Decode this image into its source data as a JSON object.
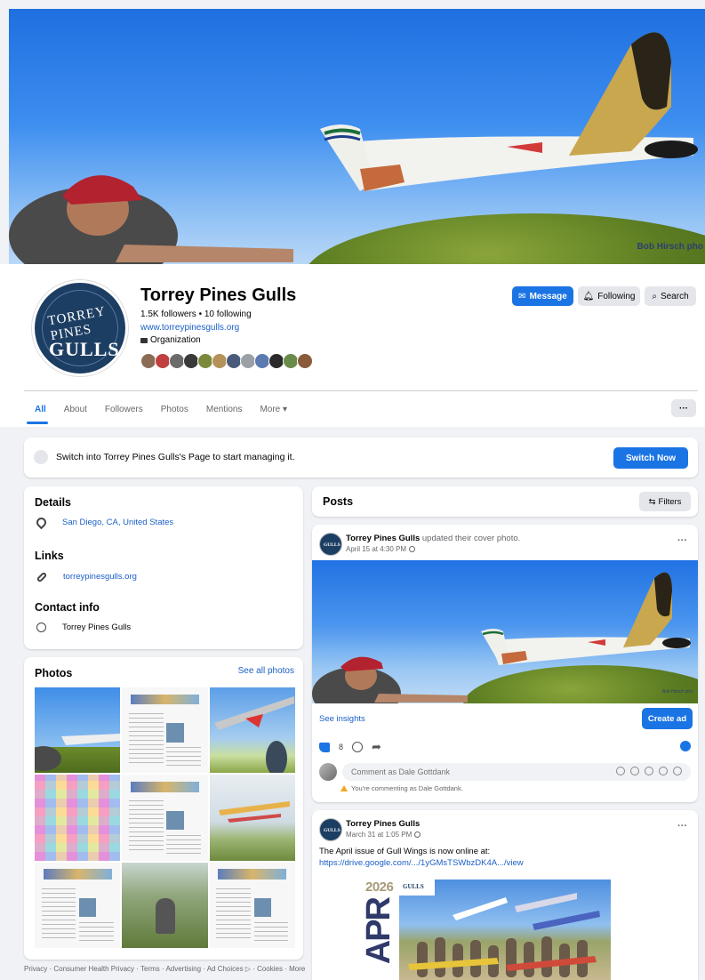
{
  "cover": {
    "credit": "Bob Hirsch pho"
  },
  "profile": {
    "name": "Torrey Pines Gulls",
    "stats": "1.5K followers • 10 following",
    "website": "www.torreypinesgulls.org",
    "category": "Organization",
    "avatar_top": "TORREY PINES",
    "avatar_bottom": "GULLS"
  },
  "actions": {
    "message": "Message",
    "following": "Following",
    "search": "Search"
  },
  "tabs": [
    {
      "label": "All"
    },
    {
      "label": "About"
    },
    {
      "label": "Followers"
    },
    {
      "label": "Photos"
    },
    {
      "label": "Mentions"
    },
    {
      "label": "More ▾"
    }
  ],
  "more_dots": "···",
  "switch_banner": {
    "text": "Switch into Torrey Pines Gulls's Page to start managing it.",
    "button": "Switch Now"
  },
  "details": {
    "title": "Details",
    "location": "San Diego, CA, United States",
    "links_title": "Links",
    "link": "torreypinesgulls.org",
    "contact_title": "Contact info",
    "contact": "Torrey Pines Gulls"
  },
  "photos": {
    "title": "Photos",
    "see_all": "See all photos"
  },
  "footer": "Privacy · Consumer Health Privacy · Terms · Advertising · Ad Choices ▷ · Cookies · More",
  "posts": {
    "title": "Posts",
    "filters": "Filters",
    "post1": {
      "author": "Torrey Pines Gulls",
      "action": " updated their cover photo.",
      "time": "April 15 at 4:30 PM",
      "insights": "See insights",
      "create_ad": "Create ad",
      "likes": "8",
      "comment_placeholder": "Comment as Dale Gottdank",
      "commenting_note": "You're commenting as Dale Gottdank."
    },
    "post2": {
      "author": "Torrey Pines Gulls",
      "time": "March 31 at 1:05 PM",
      "text": "The April issue of Gull Wings is now online at:",
      "link": "https://drive.google.com/.../1yGMsTSWbzDK4A.../view",
      "year": "2026",
      "month": "APR",
      "logo": "GULLS"
    }
  },
  "colors": {
    "accent": "#1b74e4",
    "link": "#1b5fc7",
    "background": "#f0f2f5"
  }
}
